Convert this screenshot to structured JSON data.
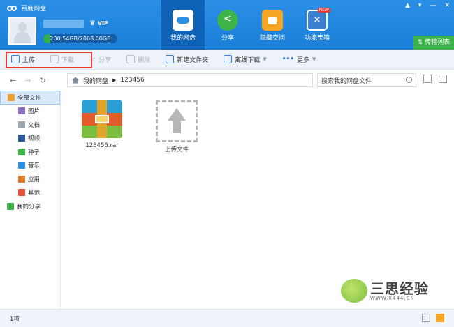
{
  "app": {
    "title": "百度网盘"
  },
  "window_controls": [
    "▲",
    "▾",
    "—",
    "✕"
  ],
  "user": {
    "vip_label": "VIP",
    "quota_text": "200.54GB/2068.00GB",
    "quota_fraction": 0.097
  },
  "nav": [
    {
      "label": "我的网盘",
      "icon": "cloud-drive-icon",
      "active": true
    },
    {
      "label": "分享",
      "icon": "share-icon",
      "active": false
    },
    {
      "label": "隐藏空间",
      "icon": "lock-icon",
      "active": false
    },
    {
      "label": "功能宝箱",
      "icon": "toolbox-icon",
      "active": false,
      "badge": "NEW"
    }
  ],
  "transfer_button": "传输列表",
  "toolbar": {
    "upload": "上传",
    "download": "下载",
    "share": "分享",
    "delete": "删除",
    "new_folder": "新建文件夹",
    "offline_download": "离线下载",
    "more": "更多"
  },
  "breadcrumb": {
    "root": "我的网盘",
    "current": "123456"
  },
  "search": {
    "placeholder": "搜索我的网盘文件"
  },
  "sidebar": [
    {
      "label": "全部文件",
      "icon": "all-files-icon",
      "active": true,
      "color": "#f0a030"
    },
    {
      "label": "图片",
      "icon": "image-icon",
      "color": "#8e6fc1"
    },
    {
      "label": "文档",
      "icon": "document-icon",
      "color": "#9aa5b1"
    },
    {
      "label": "视频",
      "icon": "video-icon",
      "color": "#2b5a9a"
    },
    {
      "label": "种子",
      "icon": "bt-icon",
      "color": "#3db34a"
    },
    {
      "label": "音乐",
      "icon": "music-icon",
      "color": "#2b8fe6"
    },
    {
      "label": "应用",
      "icon": "app-icon",
      "color": "#e07b2b"
    },
    {
      "label": "其他",
      "icon": "other-icon",
      "color": "#e5533a"
    },
    {
      "label": "我的分享",
      "icon": "my-share-icon",
      "color": "#3db34a"
    }
  ],
  "files": [
    {
      "name": "123456.rar",
      "icon": "rar-file-icon"
    },
    {
      "name": "上传文件",
      "icon": "upload-file-icon"
    }
  ],
  "status": {
    "count": "1项"
  },
  "watermark": {
    "text": "三思经验",
    "url": "WWW.X444.CN"
  }
}
